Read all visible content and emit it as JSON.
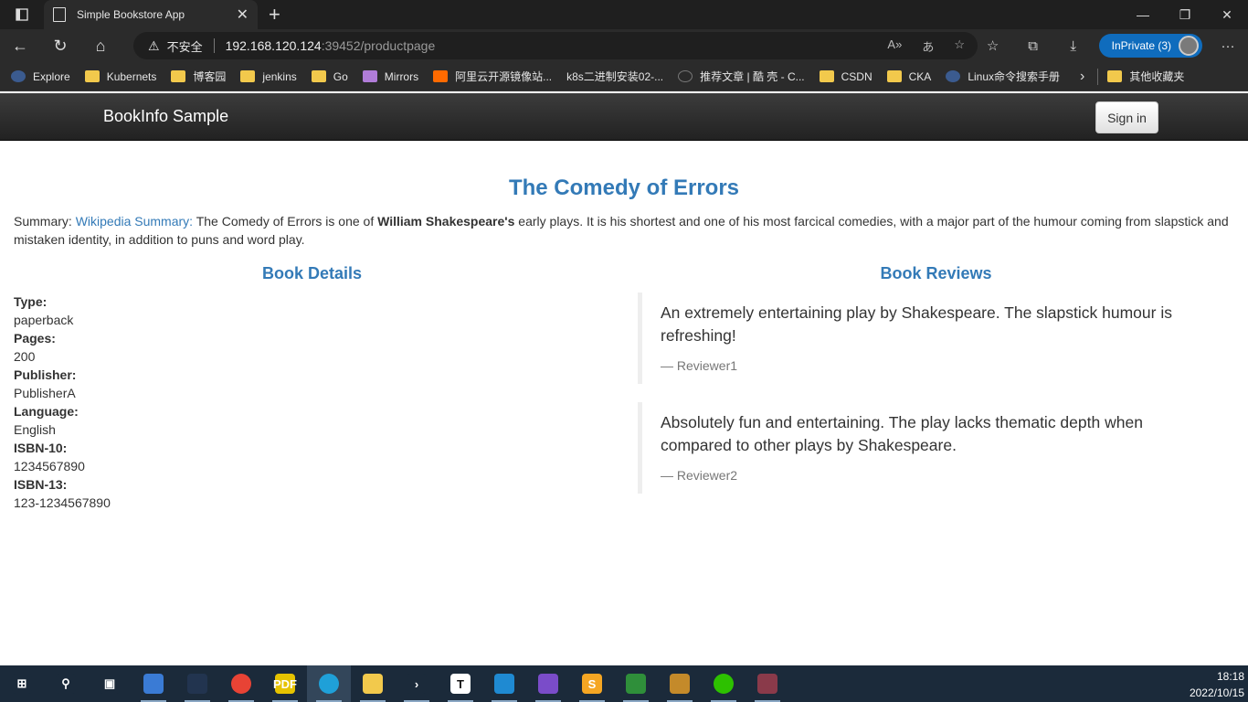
{
  "browser": {
    "tab_title": "Simple Bookstore App",
    "url_warning": "不安全",
    "url_host": "192.168.120.124",
    "url_rest": ":39452/productpage",
    "inprivate_label": "InPrivate (3)",
    "bookmarks": [
      {
        "label": "Explore",
        "icon": "globe"
      },
      {
        "label": "Kubernets",
        "icon": "folder"
      },
      {
        "label": "博客园",
        "icon": "folder"
      },
      {
        "label": "jenkins",
        "icon": "folder"
      },
      {
        "label": "Go",
        "icon": "folder"
      },
      {
        "label": "Mirrors",
        "icon": "shield"
      },
      {
        "label": "阿里云开源镜像站...",
        "icon": "aliyun"
      },
      {
        "label": "k8s二进制安装02-...",
        "icon": "none"
      },
      {
        "label": "推荐文章 | 酷 壳 - C...",
        "icon": "kunai"
      },
      {
        "label": "CSDN",
        "icon": "folder"
      },
      {
        "label": "CKA",
        "icon": "folder"
      },
      {
        "label": "Linux命令搜索手册",
        "icon": "globe"
      }
    ],
    "other_bookmarks": "其他收藏夹"
  },
  "page": {
    "brand": "BookInfo Sample",
    "signin": "Sign in",
    "title": "The Comedy of Errors",
    "summary_prefix": "Summary: ",
    "summary_link": "Wikipedia Summary:",
    "summary_text_1": " The Comedy of Errors is one of ",
    "summary_bold": "William Shakespeare's",
    "summary_text_2": " early plays. It is his shortest and one of his most farcical comedies, with a major part of the humour coming from slapstick and mistaken identity, in addition to puns and word play.",
    "details_title": "Book Details",
    "reviews_title": "Book Reviews",
    "details": [
      {
        "label": "Type:",
        "value": "paperback"
      },
      {
        "label": "Pages:",
        "value": "200"
      },
      {
        "label": "Publisher:",
        "value": "PublisherA"
      },
      {
        "label": "Language:",
        "value": "English"
      },
      {
        "label": "ISBN-10:",
        "value": "1234567890"
      },
      {
        "label": "ISBN-13:",
        "value": "123-1234567890"
      }
    ],
    "reviews": [
      {
        "text": "An extremely entertaining play by Shakespeare. The slapstick humour is refreshing!",
        "author": "— Reviewer1"
      },
      {
        "text": "Absolutely fun and entertaining. The play lacks thematic depth when compared to other plays by Shakespeare.",
        "author": "— Reviewer2"
      }
    ]
  },
  "taskbar": {
    "time": "18:18",
    "date": "2022/10/15",
    "apps": [
      {
        "name": "windows-start",
        "color": "#1b2a3a",
        "glyph": "⊞"
      },
      {
        "name": "search",
        "color": "#1b2a3a",
        "glyph": "⚲"
      },
      {
        "name": "task-view",
        "color": "#1b2a3a",
        "glyph": "▣"
      },
      {
        "name": "this-pc",
        "color": "#3a7bd5",
        "glyph": ""
      },
      {
        "name": "monitor-app",
        "color": "#22344f",
        "glyph": ""
      },
      {
        "name": "chrome",
        "color": "#e84335",
        "glyph": ""
      },
      {
        "name": "pdf-app",
        "color": "#e6c300",
        "glyph": "PDF"
      },
      {
        "name": "edge",
        "color": "#1fa0d8",
        "glyph": ""
      },
      {
        "name": "file-explorer",
        "color": "#f2c94c",
        "glyph": ""
      },
      {
        "name": "powershell-app",
        "color": "#1b2a3a",
        "glyph": "›"
      },
      {
        "name": "typora",
        "color": "#ffffff",
        "glyph": "T"
      },
      {
        "name": "vscode",
        "color": "#1f8ad2",
        "glyph": ""
      },
      {
        "name": "preview-app",
        "color": "#7a4cc9",
        "glyph": ""
      },
      {
        "name": "sublime-text",
        "color": "#f5a623",
        "glyph": "S"
      },
      {
        "name": "xshell",
        "color": "#2f8f3a",
        "glyph": ""
      },
      {
        "name": "xftp",
        "color": "#c48a2a",
        "glyph": ""
      },
      {
        "name": "wechat",
        "color": "#2dc100",
        "glyph": ""
      },
      {
        "name": "photo-app",
        "color": "#8a3a4a",
        "glyph": ""
      }
    ]
  }
}
